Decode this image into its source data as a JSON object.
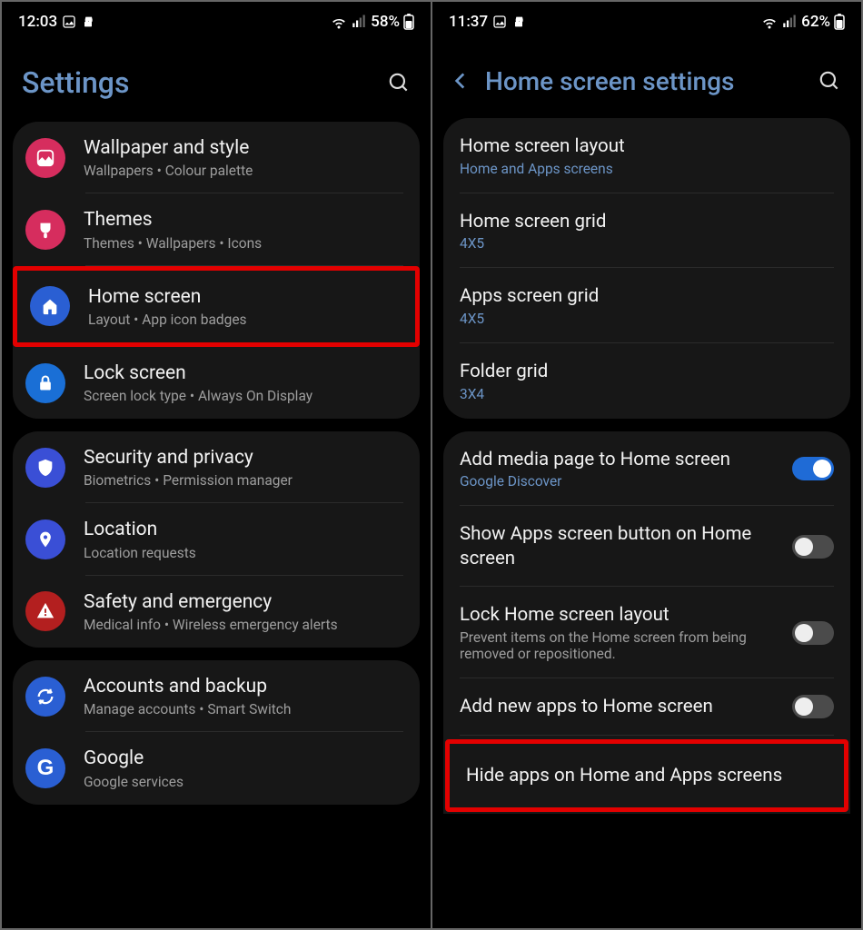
{
  "left": {
    "status": {
      "time": "12:03",
      "battery": "58%"
    },
    "header": {
      "title": "Settings"
    },
    "group1": [
      {
        "title": "Wallpaper and style",
        "sub": "Wallpapers  •  Colour palette",
        "icon": "wallpaper",
        "color": "#d62d5e"
      },
      {
        "title": "Themes",
        "sub": "Themes  •  Wallpapers  •  Icons",
        "icon": "themes",
        "color": "#d62d5e"
      },
      {
        "title": "Home screen",
        "sub": "Layout  •  App icon badges",
        "icon": "home",
        "color": "#2a5fd3",
        "highlight": true
      },
      {
        "title": "Lock screen",
        "sub": "Screen lock type  •  Always On Display",
        "icon": "lock",
        "color": "#1a6fd6"
      }
    ],
    "group2": [
      {
        "title": "Security and privacy",
        "sub": "Biometrics  •  Permission manager",
        "icon": "shield",
        "color": "#3a4fd6"
      },
      {
        "title": "Location",
        "sub": "Location requests",
        "icon": "pin",
        "color": "#3a4fd6"
      },
      {
        "title": "Safety and emergency",
        "sub": "Medical info  •  Wireless emergency alerts",
        "icon": "alert",
        "color": "#b31f1f"
      }
    ],
    "group3": [
      {
        "title": "Accounts and backup",
        "sub": "Manage accounts  •  Smart Switch",
        "icon": "sync",
        "color": "#2a5fd3"
      },
      {
        "title": "Google",
        "sub": "Google services",
        "icon": "google",
        "color": "#2a5fd3"
      }
    ]
  },
  "right": {
    "status": {
      "time": "11:37",
      "battery": "62%"
    },
    "header": {
      "title": "Home screen settings"
    },
    "group1": [
      {
        "title": "Home screen layout",
        "sub": "Home and Apps screens",
        "subblue": true
      },
      {
        "title": "Home screen grid",
        "sub": "4X5",
        "subblue": true
      },
      {
        "title": "Apps screen grid",
        "sub": "4X5",
        "subblue": true
      },
      {
        "title": "Folder grid",
        "sub": "3X4",
        "subblue": true
      }
    ],
    "group2": [
      {
        "title": "Add media page to Home screen",
        "sub": "Google Discover",
        "subblue": true,
        "toggle": "on"
      },
      {
        "title": "Show Apps screen button on Home screen",
        "toggle": "off"
      },
      {
        "title": "Lock Home screen layout",
        "sub": "Prevent items on the Home screen from being removed or repositioned.",
        "toggle": "off"
      },
      {
        "title": "Add new apps to Home screen",
        "toggle": "off"
      },
      {
        "title": "Hide apps on Home and Apps screens",
        "highlight": true
      }
    ]
  }
}
